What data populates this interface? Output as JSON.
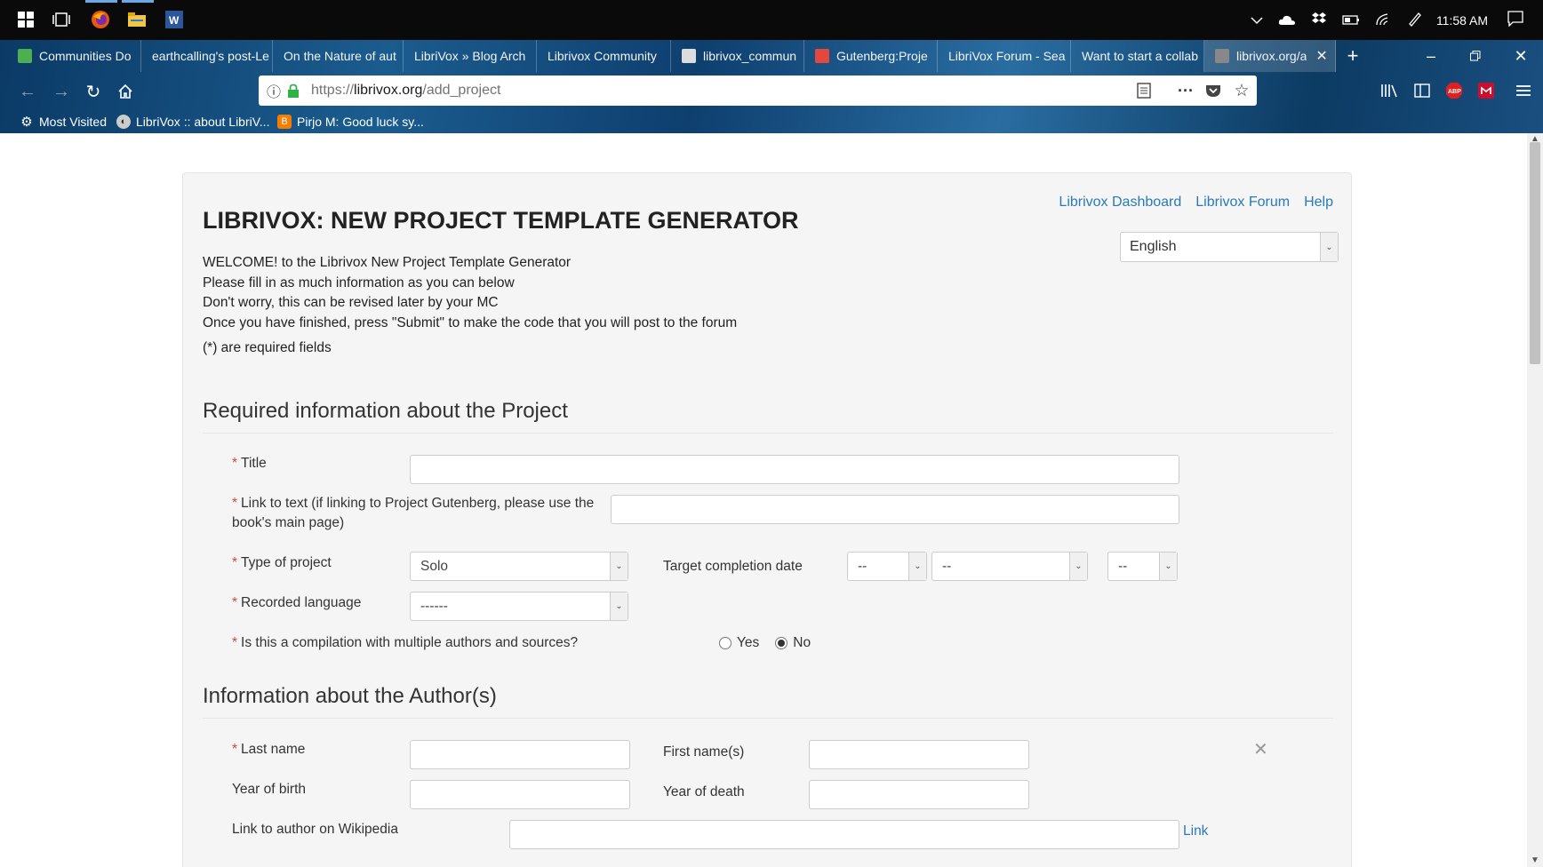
{
  "taskbar": {
    "time": "11:58 AM",
    "icons": [
      "windows-start-icon",
      "task-view-icon",
      "firefox-icon",
      "file-explorer-icon",
      "word-icon"
    ]
  },
  "browser": {
    "tabs": [
      {
        "label": "Communities Do",
        "favicon_color": "#4caf50"
      },
      {
        "label": "earthcalling's post-Le",
        "favicon_color": ""
      },
      {
        "label": "On the Nature of aut",
        "favicon_color": ""
      },
      {
        "label": "LibriVox » Blog Arch",
        "favicon_color": ""
      },
      {
        "label": "Librivox Community",
        "favicon_color": ""
      },
      {
        "label": "librivox_commun",
        "favicon_color": "#dddddd"
      },
      {
        "label": "Gutenberg:Proje",
        "favicon_color": "#e2483d"
      },
      {
        "label": "LibriVox Forum - Sea",
        "favicon_color": ""
      },
      {
        "label": "Want to start a collab",
        "favicon_color": ""
      },
      {
        "label": "librivox.org/a",
        "favicon_color": "#888888"
      }
    ],
    "url_scheme": "https://",
    "url_host": "librivox.org",
    "url_path": "/add_project",
    "bookmarks": [
      {
        "label": "Most Visited"
      },
      {
        "label": "LibriVox :: about LibriV..."
      },
      {
        "label": "Pirjo M: Good luck sy..."
      }
    ]
  },
  "page": {
    "top_links": [
      "Librivox Dashboard",
      "Librivox Forum",
      "Help"
    ],
    "language_selected": "English",
    "title": "LIBRIVOX: NEW PROJECT TEMPLATE GENERATOR",
    "intro_lines": [
      "WELCOME! to the Librivox New Project Template Generator",
      "Please fill in as much information as you can below",
      "Don't worry, this can be revised later by your MC",
      "Once you have finished, press \"Submit\" to make the code that you will post to the forum"
    ],
    "required_note": "(*) are required fields",
    "required_section": {
      "heading": "Required information about the Project",
      "title_label": "Title",
      "link_label_line1": "Link to text (if linking to Project Gutenberg, please use the",
      "link_label_line2": "book's main page)",
      "type_label": "Type of project",
      "type_value": "Solo",
      "target_date_label": "Target completion date",
      "date_day": "--",
      "date_month": "--",
      "date_year": "--",
      "language_label": "Recorded language",
      "language_value": "------",
      "compilation_label": "Is this a compilation with multiple authors and sources?",
      "yes_label": "Yes",
      "no_label": "No",
      "compilation_selected": "No"
    },
    "author_section": {
      "heading": "Information about the Author(s)",
      "last_name_label": "Last name",
      "first_name_label": "First name(s)",
      "birth_label": "Year of birth",
      "death_label": "Year of death",
      "wiki_label": "Link to author on Wikipedia",
      "wiki_link": "Link",
      "remove_symbol": "✕"
    },
    "required_marker": "*"
  }
}
